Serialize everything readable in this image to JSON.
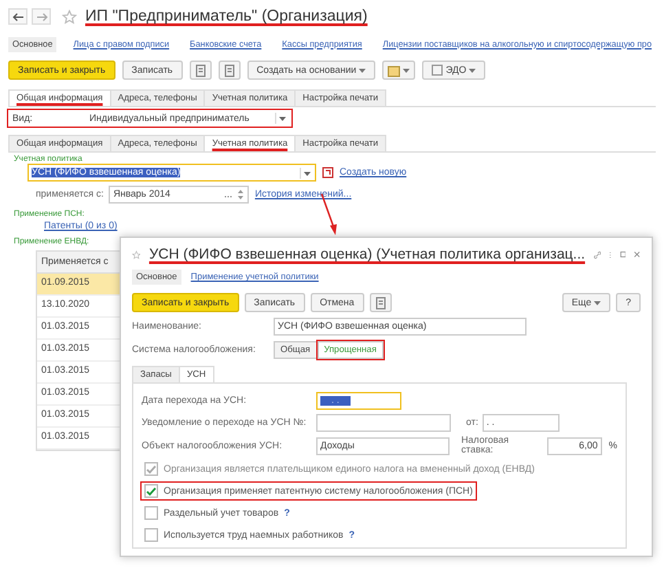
{
  "window": {
    "title": "ИП \"Предприниматель\" (Организация)",
    "marked": true
  },
  "nav": [
    {
      "label": "Основное",
      "selected": true
    },
    {
      "label": "Лица с правом подписи",
      "selected": false
    },
    {
      "label": "Банковские счета",
      "selected": false
    },
    {
      "label": "Кассы предприятия",
      "selected": false
    },
    {
      "label": "Лицензии поставщиков на алкогольную и спиртосодержащую про",
      "selected": false
    }
  ],
  "toolbar": [
    {
      "kind": "primary",
      "label": "Записать и закрыть"
    },
    {
      "kind": "button",
      "label": "Записать"
    },
    {
      "kind": "icon"
    },
    {
      "kind": "icon"
    },
    {
      "kind": "menu",
      "label": "Создать на основании"
    },
    {
      "kind": "icon-menu"
    },
    {
      "kind": "edo",
      "label": "ЭДО"
    }
  ],
  "tabs_top": [
    {
      "label": "Общая информация",
      "selected": true,
      "marked": true
    },
    {
      "label": "Адреса, телефоны",
      "selected": false,
      "marked": false
    },
    {
      "label": "Учетная политика",
      "selected": false,
      "marked": false
    },
    {
      "label": "Настройка печати",
      "selected": false,
      "marked": false
    }
  ],
  "kind_field": {
    "label": "Вид:",
    "value": "Индивидуальный предприниматель",
    "marked": true
  },
  "tabs": [
    {
      "label": "Общая информация",
      "selected": false,
      "marked": false
    },
    {
      "label": "Адреса, телефоны",
      "selected": false,
      "marked": false
    },
    {
      "label": "Учетная политика",
      "selected": true,
      "marked": true
    },
    {
      "label": "Настройка печати",
      "selected": false,
      "marked": false
    }
  ],
  "policy": {
    "label": "Учетная политика",
    "value": "УСН (ФИФО взвешенная оценка)",
    "focused": true,
    "highlighted": true,
    "create_link": "Создать новую",
    "applies_label": "применяется с:",
    "applies_value": "Январь 2014",
    "history_link": "История изменений..."
  },
  "psn": {
    "label": "Применение ПСН:",
    "link": "Патенты (0 из 0)"
  },
  "envd": {
    "label": "Применение ЕНВД:"
  },
  "table": {
    "columns": [
      "Применяется с"
    ],
    "rows": [
      {
        "cells": [
          "01.09.2015"
        ],
        "selected": true
      },
      {
        "cells": [
          "13.10.2020"
        ],
        "selected": false
      },
      {
        "cells": [
          "01.03.2015"
        ],
        "selected": false
      },
      {
        "cells": [
          "01.03.2015"
        ],
        "selected": false
      },
      {
        "cells": [
          "01.03.2015"
        ],
        "selected": false
      },
      {
        "cells": [
          "01.03.2015"
        ],
        "selected": false
      },
      {
        "cells": [
          "01.03.2015"
        ],
        "selected": false
      },
      {
        "cells": [
          "01.03.2015"
        ],
        "selected": false
      }
    ]
  },
  "dialog": {
    "title": "УСН (ФИФО взвешенная оценка) (Учетная политика организац...",
    "marked": true,
    "nav": [
      {
        "label": "Основное",
        "selected": true
      },
      {
        "label": "Применение учетной политики",
        "selected": false
      }
    ],
    "buttons": [
      {
        "kind": "primary",
        "label": "Записать и закрыть"
      },
      {
        "kind": "button",
        "label": "Записать"
      },
      {
        "kind": "button",
        "label": "Отмена"
      },
      {
        "kind": "icon"
      }
    ],
    "more": "Еще",
    "help": "?",
    "name_label": "Наименование:",
    "name_value": "УСН (ФИФО взвешенная оценка)",
    "system_label": "Система налогообложения:",
    "system": [
      {
        "label": "Общая",
        "selected": false,
        "marked": false
      },
      {
        "label": "Упрощенная",
        "selected": true,
        "marked": true
      }
    ],
    "tabs": [
      {
        "label": "Запасы",
        "selected": false
      },
      {
        "label": "УСН",
        "selected": true
      }
    ],
    "date_label": "Дата перехода на УСН:",
    "date_value": ". .",
    "date_focused": true,
    "date_highlighted": true,
    "notice_label": "Уведомление о переходе на УСН №:",
    "notice_from_label": "от:",
    "notice_from_value": ". .",
    "object_label": "Объект налогообложения УСН:",
    "object_value": "Доходы",
    "rate_label": "Налоговая ставка:",
    "rate_value": "6,00",
    "rate_unit": "%",
    "checks": [
      {
        "label": "Организация является плательщиком единого налога на вмененный доход (ЕНВД)",
        "checked": true,
        "disabled": true,
        "marked": false
      },
      {
        "label": "Организация применяет патентную систему налогообложения (ПСН)",
        "checked": true,
        "disabled": false,
        "marked": true
      },
      {
        "label": "Раздельный учет товаров",
        "checked": false,
        "disabled": false,
        "marked": false,
        "help": "?"
      },
      {
        "label": "Используется труд наемных работников",
        "checked": false,
        "disabled": false,
        "marked": false,
        "help": "?"
      }
    ]
  }
}
